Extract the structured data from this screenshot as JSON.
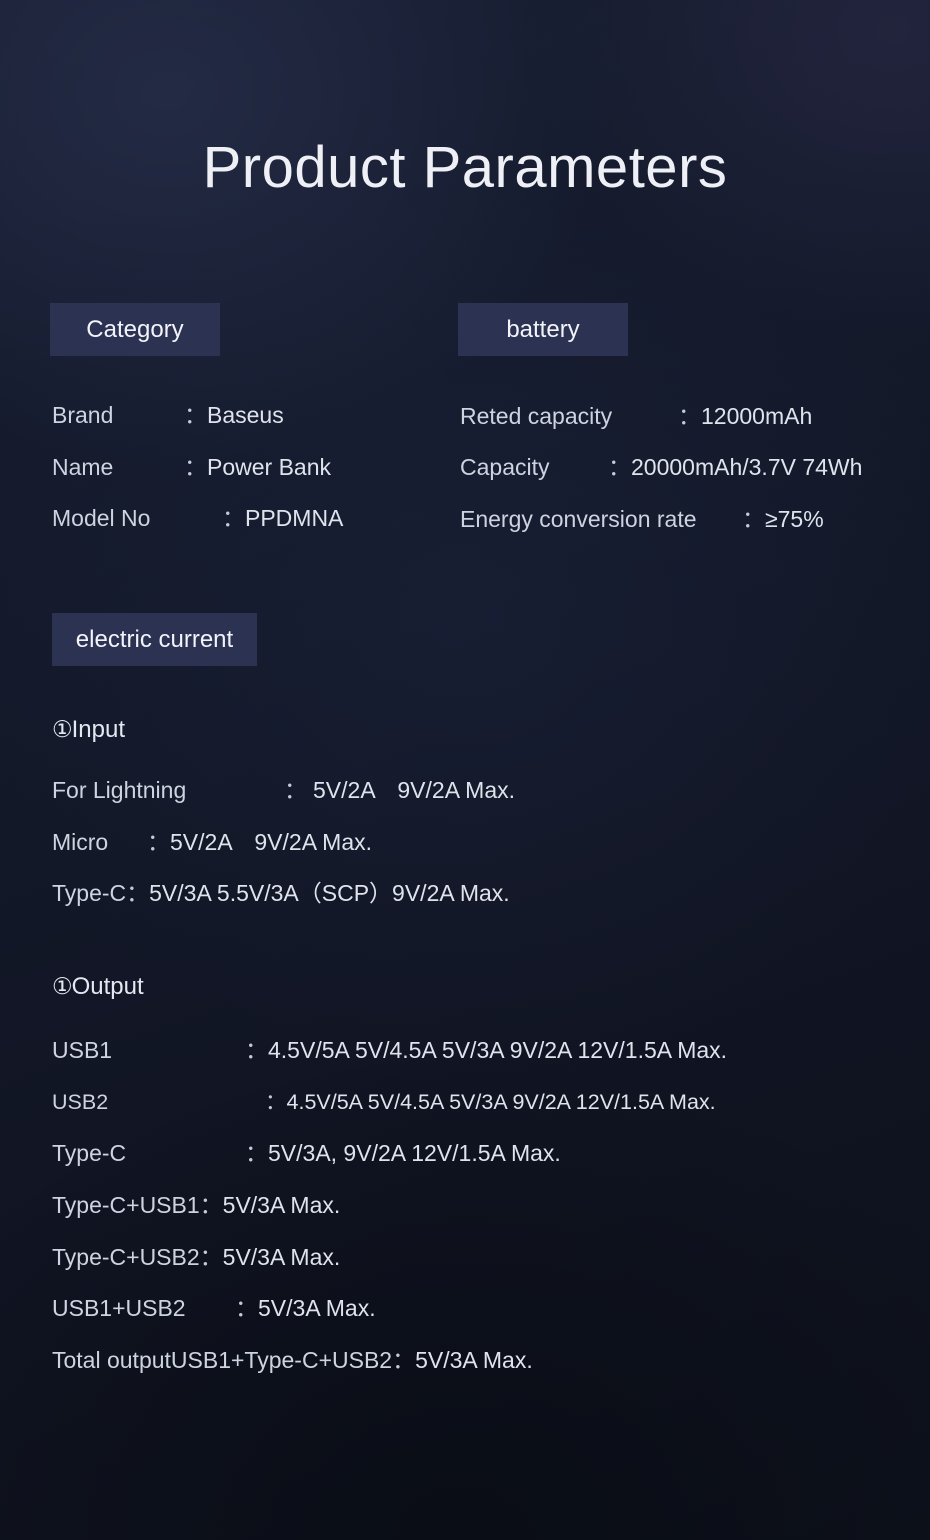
{
  "page": {
    "title": "Product Parameters",
    "colors": {
      "background_top_left": "#161b2e",
      "background_top_right": "#141826",
      "background_bottom_right": "#0e121c",
      "badge_background": "#2c3252",
      "text": "#ced3e0",
      "title_text": "#eef0f6"
    }
  },
  "sections": {
    "category": {
      "badge_label": "Category",
      "rows": [
        {
          "label": "Brand",
          "sep": "：",
          "value": "Baseus"
        },
        {
          "label": "Name",
          "sep": "：",
          "value": "Power Bank"
        },
        {
          "label": "Model No",
          "sep": "：",
          "value": "PPDMNA"
        }
      ]
    },
    "battery": {
      "badge_label": "battery",
      "rows": [
        {
          "label": "Reted capacity",
          "sep": "：",
          "value": "12000mAh"
        },
        {
          "label": "Capacity",
          "sep": "：",
          "value": "20000mAh/3.7V 74Wh"
        },
        {
          "label": "Energy conversion rate",
          "sep": "：",
          "value": "≥75%"
        }
      ]
    },
    "electric_current": {
      "badge_label": "electric current",
      "input": {
        "heading_marker": "①",
        "heading": "Input",
        "rows": [
          {
            "label": "For Lightning",
            "sep": "：",
            "value": "5V/2A　9V/2A  Max."
          },
          {
            "label": "Micro",
            "sep": "：",
            "value": "5V/2A　9V/2A  Max."
          },
          {
            "label": "Type-C",
            "sep": "：",
            "value": "5V/3A 5.5V/3A（SCP）9V/2A Max."
          }
        ]
      },
      "output": {
        "heading_marker": "①",
        "heading": "Output",
        "rows": [
          {
            "label": "USB1",
            "sep": "：",
            "value": "4.5V/5A 5V/4.5A  5V/3A 9V/2A 12V/1.5A Max."
          },
          {
            "label": "USB2",
            "sep": "：",
            "value": "4.5V/5A 5V/4.5A  5V/3A 9V/2A 12V/1.5A Max."
          },
          {
            "label": "Type-C",
            "sep": "：",
            "value": "5V/3A, 9V/2A  12V/1.5A Max."
          },
          {
            "label": "Type-C+USB1",
            "sep": "：",
            "value": "5V/3A Max."
          },
          {
            "label": "Type-C+USB2",
            "sep": "：",
            "value": "5V/3A Max."
          },
          {
            "label": "USB1+USB2",
            "sep": "：",
            "value": "5V/3A Max."
          },
          {
            "label": "Total outputUSB1+Type-C+USB2",
            "sep": "：",
            "value": "5V/3A Max."
          }
        ]
      }
    }
  }
}
